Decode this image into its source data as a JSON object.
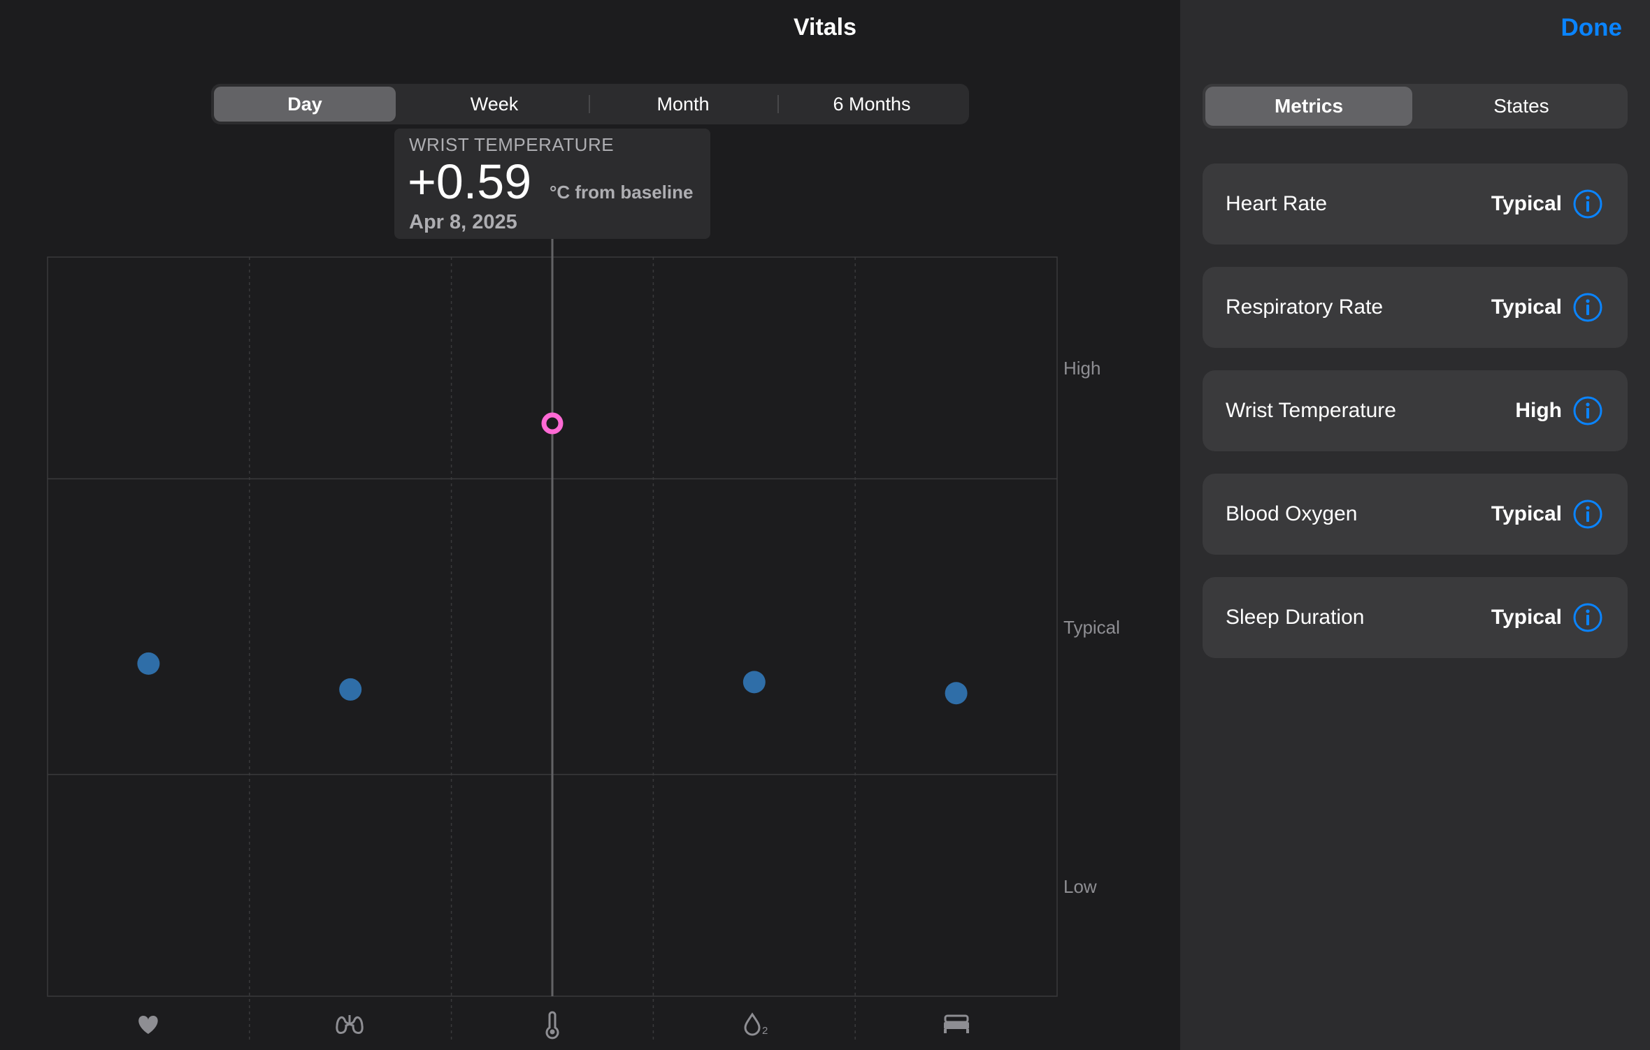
{
  "header": {
    "title": "Vitals",
    "done_label": "Done"
  },
  "range_tabs": [
    {
      "label": "Day",
      "active": true
    },
    {
      "label": "Week",
      "active": false
    },
    {
      "label": "Month",
      "active": false
    },
    {
      "label": "6 Months",
      "active": false
    }
  ],
  "tooltip": {
    "metric": "WRIST TEMPERATURE",
    "value": "+0.59",
    "unit": "°C from baseline",
    "date": "Apr 8, 2025"
  },
  "chart_data": {
    "type": "scatter",
    "y_levels": [
      "High",
      "Typical",
      "Low"
    ],
    "categories": [
      "Heart Rate",
      "Respiratory Rate",
      "Wrist Temperature",
      "Blood Oxygen",
      "Sleep Duration"
    ],
    "category_icons": [
      "heart-icon",
      "lungs-icon",
      "thermometer-icon",
      "blood-oxygen-icon",
      "bed-icon"
    ],
    "ylim": [
      -1,
      1
    ],
    "values": [
      -0.1,
      -0.17,
      0.55,
      -0.15,
      -0.18
    ],
    "selected_index": 2,
    "colors": {
      "point": "#2f6ea8",
      "selected": "#ff6ad5"
    }
  },
  "panel": {
    "tabs": [
      {
        "label": "Metrics",
        "active": true
      },
      {
        "label": "States",
        "active": false
      }
    ],
    "metrics": [
      {
        "name": "Heart Rate",
        "status": "Typical"
      },
      {
        "name": "Respiratory Rate",
        "status": "Typical"
      },
      {
        "name": "Wrist Temperature",
        "status": "High"
      },
      {
        "name": "Blood Oxygen",
        "status": "Typical"
      },
      {
        "name": "Sleep Duration",
        "status": "Typical"
      }
    ]
  },
  "colors": {
    "accent": "#0a84ff"
  }
}
